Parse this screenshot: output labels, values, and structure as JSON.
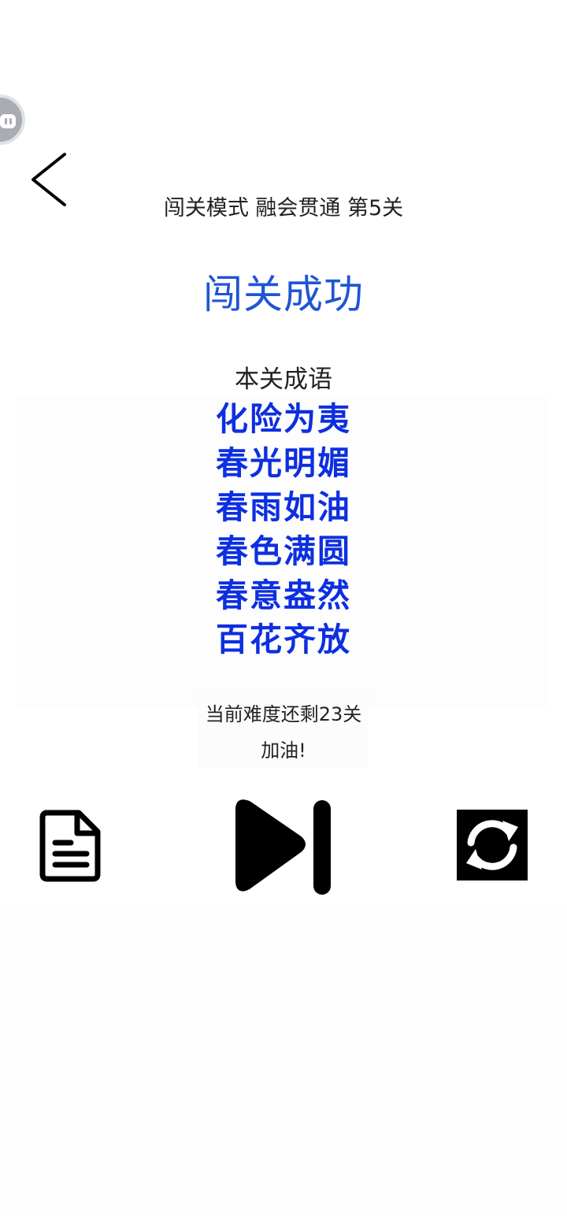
{
  "header": {
    "subtitle": "闯关模式 融会贯通 第5关"
  },
  "result": {
    "title": "闯关成功",
    "idioms_label": "本关成语",
    "idioms": [
      "化险为夷",
      "春光明媚",
      "春雨如油",
      "春色满圆",
      "春意盎然",
      "百花齐放"
    ]
  },
  "status": {
    "remaining": "当前难度还剩23关",
    "cheer": "加油!"
  },
  "icons": {
    "floating": "assistant-bubble-icon",
    "back": "chevron-left-icon",
    "doc": "document-icon",
    "next": "skip-next-icon",
    "refresh": "refresh-icon"
  },
  "colors": {
    "title": "#1f54d6",
    "idiom": "#0d2fe0",
    "icon": "#000000",
    "bubble": "#a9acb3"
  }
}
